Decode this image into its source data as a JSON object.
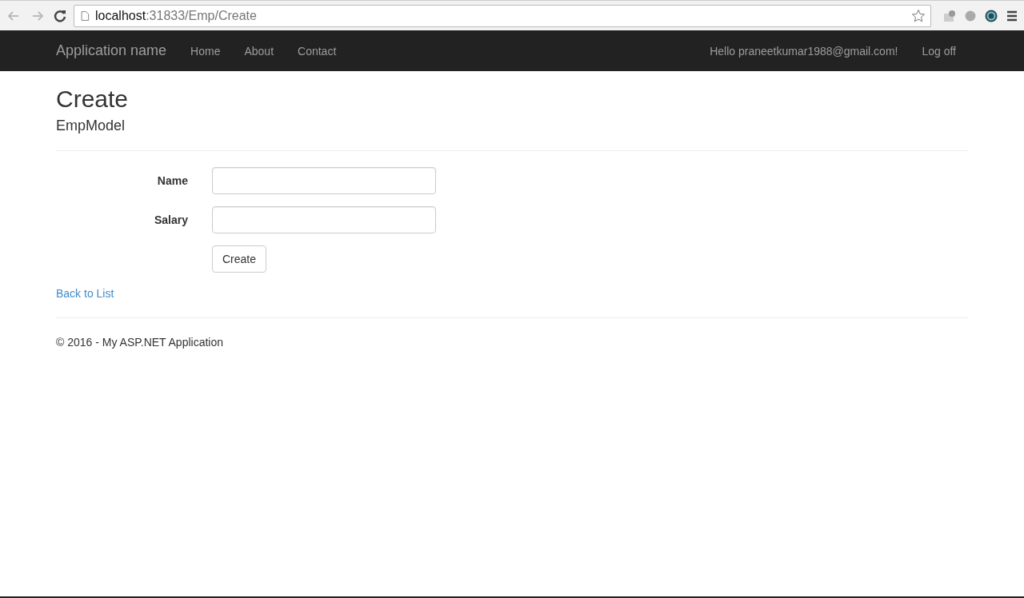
{
  "browser": {
    "address": {
      "host": "localhost",
      "rest": ":31833/Emp/Create"
    }
  },
  "navbar": {
    "brand": "Application name",
    "links": [
      "Home",
      "About",
      "Contact"
    ],
    "greeting": "Hello praneetkumar1988@gmail.com!",
    "logoff": "Log off"
  },
  "page": {
    "title": "Create",
    "subtitle": "EmpModel"
  },
  "form": {
    "fields": [
      {
        "label": "Name"
      },
      {
        "label": "Salary"
      }
    ],
    "submit": "Create"
  },
  "back_link": "Back to List",
  "footer": "© 2016 - My ASP.NET Application"
}
